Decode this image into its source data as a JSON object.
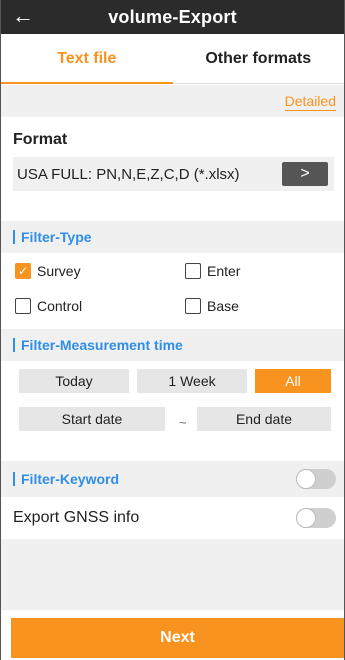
{
  "header": {
    "back_icon": "arrow-left-icon",
    "title": "volume-Export"
  },
  "tabs": [
    {
      "label": "Text file",
      "active": true
    },
    {
      "label": "Other formats",
      "active": false
    }
  ],
  "detailed_link": "Detailed",
  "format": {
    "label": "Format",
    "value": "USA FULL: PN,N,E,Z,C,D (*.xlsx)",
    "button_icon": "chevron-right-icon",
    "button_glyph": ">"
  },
  "filter_type": {
    "label": "Filter-Type",
    "options": [
      {
        "label": "Survey",
        "checked": true
      },
      {
        "label": "Enter",
        "checked": false
      },
      {
        "label": "Control",
        "checked": false
      },
      {
        "label": "Base",
        "checked": false
      }
    ]
  },
  "filter_time": {
    "label": "Filter-Measurement time",
    "ranges": [
      {
        "label": "Today",
        "active": false
      },
      {
        "label": "1 Week",
        "active": false
      },
      {
        "label": "All",
        "active": true
      }
    ],
    "start_date_placeholder": "Start date",
    "separator": "~",
    "end_date_placeholder": "End date"
  },
  "filter_keyword": {
    "label": "Filter-Keyword",
    "enabled": false
  },
  "gnss": {
    "label": "Export GNSS info",
    "enabled": false
  },
  "next_button": "Next",
  "colors": {
    "accent": "#f7931e",
    "section_blue": "#2f8ee5",
    "topbar": "#2b2b2b"
  }
}
